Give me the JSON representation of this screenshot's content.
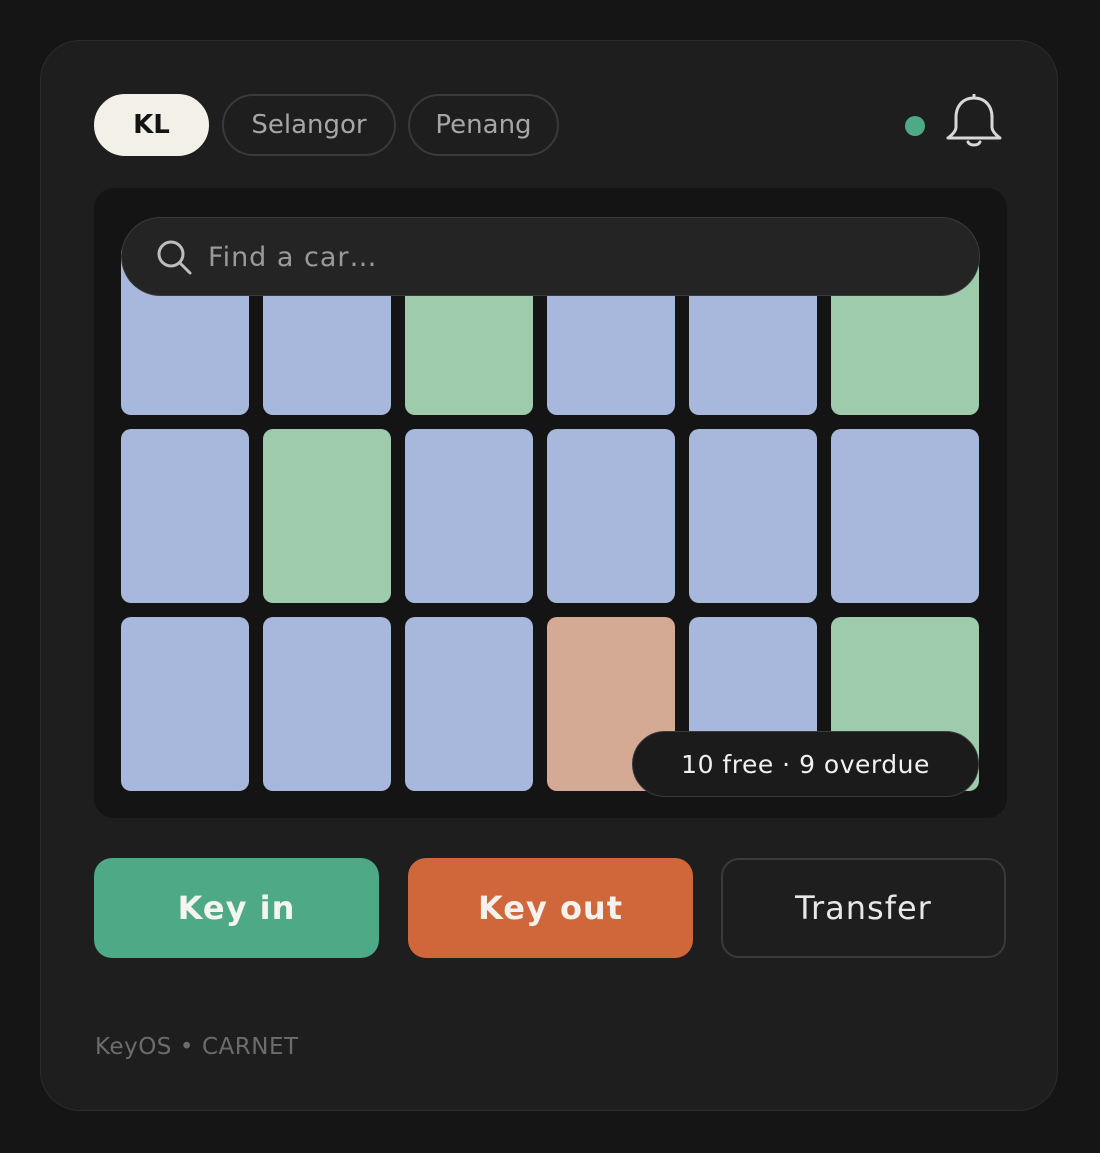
{
  "regions": [
    {
      "label": "KL",
      "active": true
    },
    {
      "label": "Selangor",
      "active": false
    },
    {
      "label": "Penang",
      "active": false
    }
  ],
  "status": {
    "online": true,
    "color": "#4ea987"
  },
  "notifications": {
    "icon": "bell-icon"
  },
  "search": {
    "placeholder": "Find a car…",
    "value": "",
    "icon": "search-icon"
  },
  "colors": {
    "available": "#9ecbab",
    "occupied": "#a8b8dd",
    "overdue": "#d4aa94"
  },
  "slots": [
    [
      "occupied",
      "occupied",
      "available",
      "occupied",
      "occupied",
      "available"
    ],
    [
      "occupied",
      "available",
      "occupied",
      "occupied",
      "occupied",
      "occupied"
    ],
    [
      "occupied",
      "occupied",
      "occupied",
      "overdue",
      "occupied",
      "available"
    ]
  ],
  "summary": "10 free · 9 overdue",
  "actions": {
    "key_in": "Key in",
    "key_out": "Key out",
    "transfer": "Transfer"
  },
  "footer": {
    "brand": "KeyOS",
    "separator": "•",
    "client": "CARNET"
  }
}
